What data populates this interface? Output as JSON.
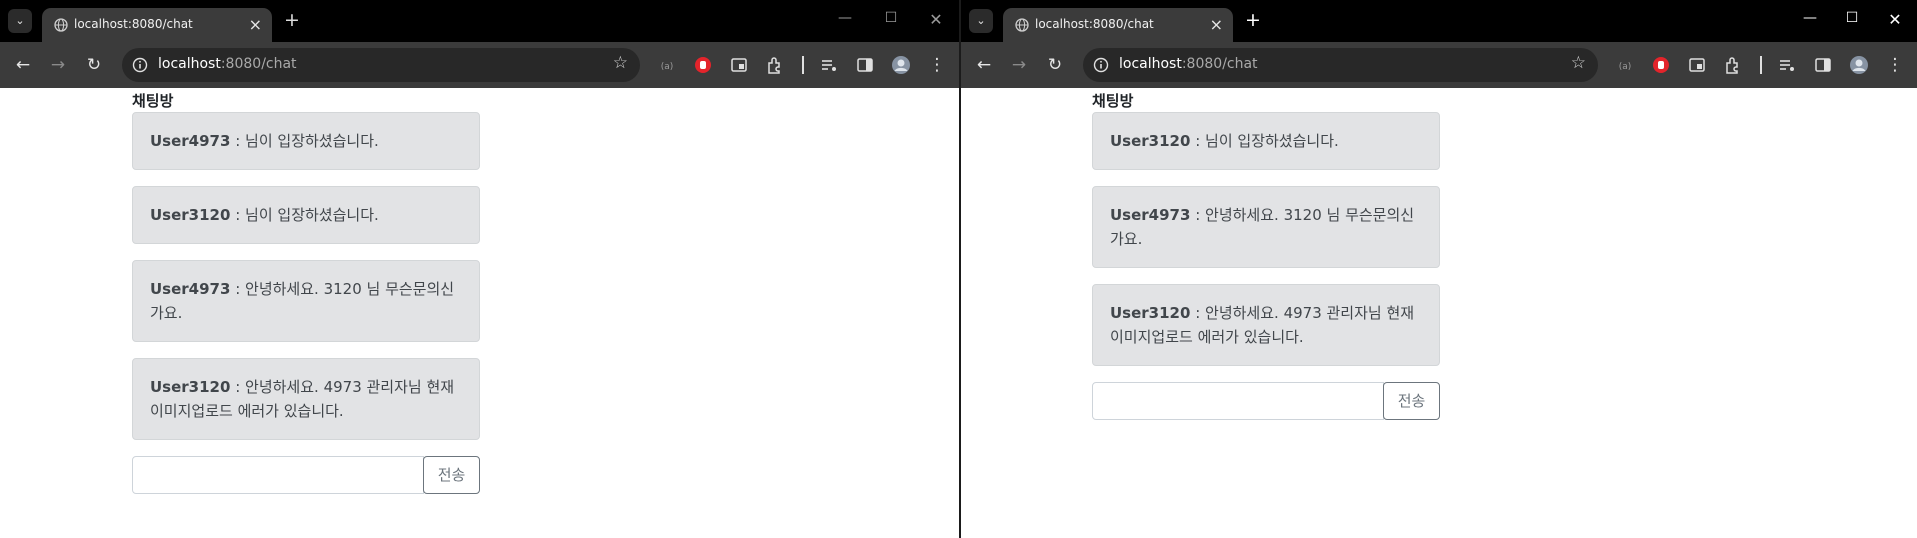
{
  "left_window": {
    "tab": {
      "title": "localhost:8080/chat",
      "favicon": "globe-icon"
    },
    "address": {
      "host": "localhost",
      "path": ":8080/chat"
    },
    "page": {
      "title": "채팅방",
      "messages": [
        {
          "user": "User4973",
          "sep": " : ",
          "text": "님이 입장하셨습니다."
        },
        {
          "user": "User3120",
          "sep": " : ",
          "text": "님이 입장하셨습니다."
        },
        {
          "user": "User4973",
          "sep": " : ",
          "text": "안녕하세요. 3120 님 무슨문의신가요."
        },
        {
          "user": "User3120",
          "sep": " : ",
          "text": "안녕하세요. 4973 관리자님 현재 이미지업로드 에러가 있습니다."
        }
      ],
      "input_value": "",
      "send_label": "전송"
    }
  },
  "right_window": {
    "tab": {
      "title": "localhost:8080/chat",
      "favicon": "globe-icon"
    },
    "address": {
      "host": "localhost",
      "path": ":8080/chat"
    },
    "page": {
      "title": "채팅방",
      "messages": [
        {
          "user": "User3120",
          "sep": " : ",
          "text": "님이 입장하셨습니다."
        },
        {
          "user": "User4973",
          "sep": " : ",
          "text": "안녕하세요. 3120 님 무슨문의신가요."
        },
        {
          "user": "User3120",
          "sep": " : ",
          "text": "안녕하세요. 4973 관리자님 현재 이미지업로드 에러가 있습니다."
        }
      ],
      "input_value": "",
      "send_label": "전송"
    }
  },
  "colors": {
    "message_bg": "#e2e3e5",
    "message_text": "#41464b",
    "send_border": "#6c757d",
    "browser_toolbar": "#3b3b3b"
  },
  "icons": [
    "tab-list-icon",
    "globe-icon",
    "close-icon",
    "new-tab-icon",
    "minimize-icon",
    "maximize-icon",
    "back-icon",
    "forward-icon",
    "reload-icon",
    "site-info-icon",
    "bookmark-star-icon",
    "extension-icon",
    "side-panel-icon",
    "profile-avatar-icon",
    "menu-icon"
  ]
}
